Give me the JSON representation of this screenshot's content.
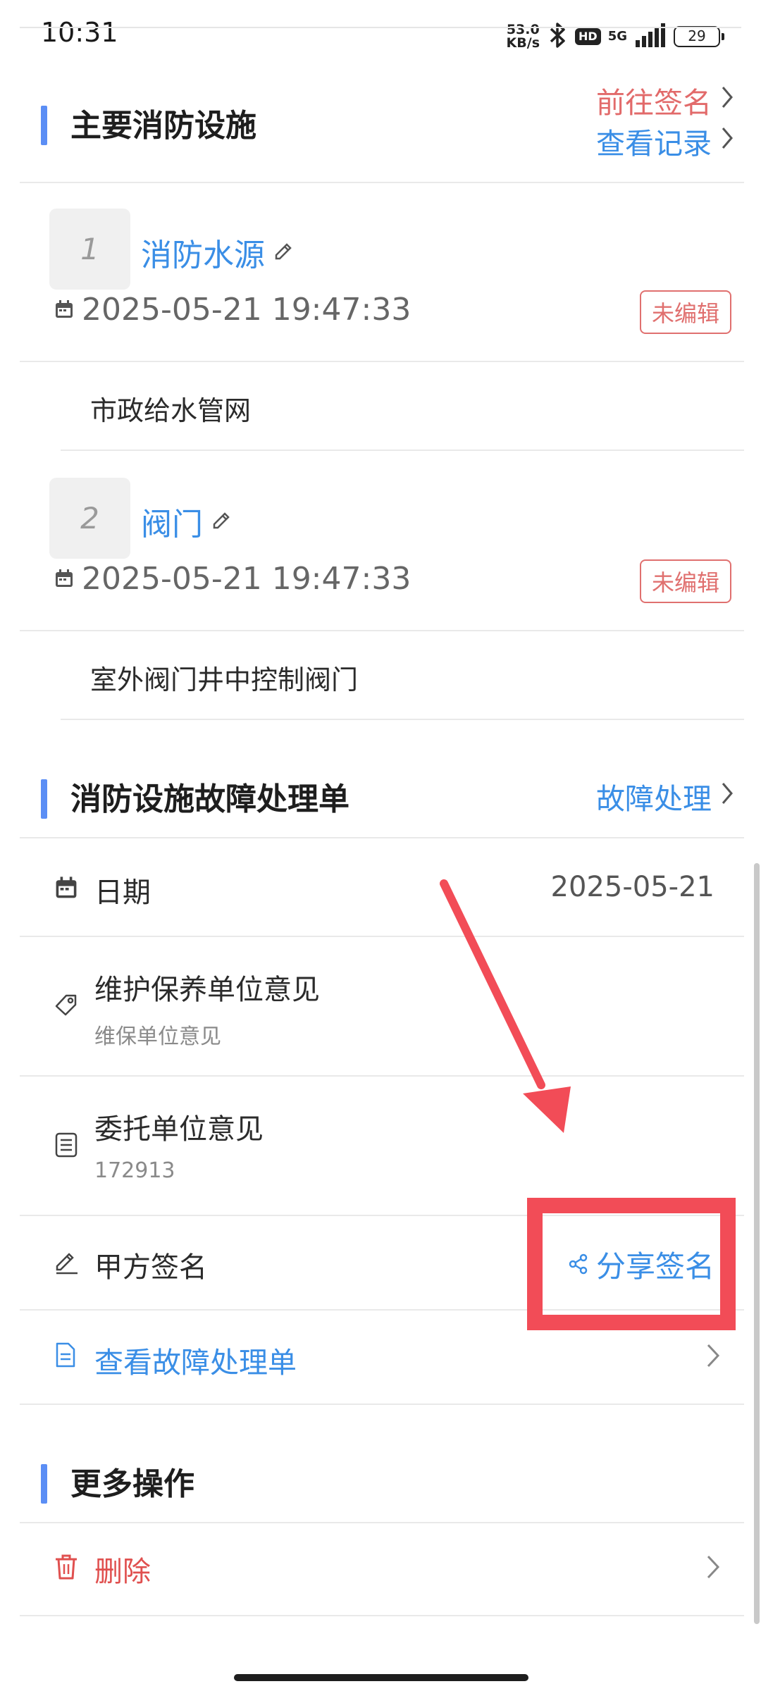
{
  "status": {
    "time": "10:31",
    "net_speed_value": "53.0",
    "net_speed_unit": "KB/s",
    "hd": "HD",
    "network": "5G",
    "battery": "29"
  },
  "section_main": {
    "title": "主要消防设施",
    "link_sign": "前往签名",
    "link_records": "查看记录",
    "items": [
      {
        "number": "1",
        "name": "消防水源",
        "datetime": "2025-05-21 19:47:33",
        "badge": "未编辑",
        "description": "市政给水管网"
      },
      {
        "number": "2",
        "name": "阀门",
        "datetime": "2025-05-21 19:47:33",
        "badge": "未编辑",
        "description": "室外阀门井中控制阀门"
      }
    ]
  },
  "section_fault": {
    "title": "消防设施故障处理单",
    "link": "故障处理",
    "date_label": "日期",
    "date_value": "2025-05-21",
    "maintenance_label": "维护保养单位意见",
    "maintenance_value": "维保单位意见",
    "client_label": "委托单位意见",
    "client_value": "172913",
    "signature_label": "甲方签名",
    "share_sign": "分享签名",
    "view_fault_sheet": "查看故障处理单"
  },
  "section_more": {
    "title": "更多操作",
    "delete": "删除"
  },
  "colors": {
    "accent": "#5b8ef5",
    "link_blue": "#3a8ee6",
    "link_red": "#e26a6a",
    "annotation_red": "#f24c57"
  }
}
